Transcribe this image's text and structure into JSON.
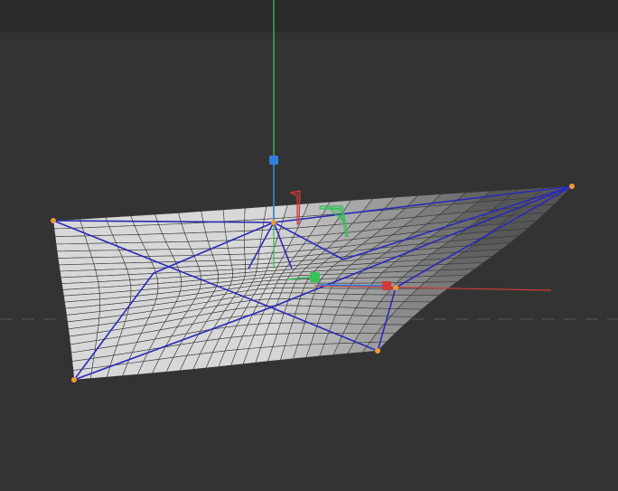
{
  "viewport": {
    "background_color": "#333333",
    "top_bar_color": "#2a2a2a"
  },
  "scene": {
    "surface_fill_color": "#d8d8d8",
    "surface_shadow_color": "#555555",
    "mesh_line_color": "#3a3a3a",
    "cage_color": "#2a2ab8",
    "control_point_color": "#f29a2e",
    "horizon_line_color": "#5a5a5a"
  },
  "gizmo": {
    "x_axis_color": "#d23a3a",
    "y_axis_color": "#39c05a",
    "z_axis_color": "#2f7fe0",
    "plane_handle_xy_color": "#d23a3a",
    "plane_handle_yz_color": "#39c05a"
  }
}
